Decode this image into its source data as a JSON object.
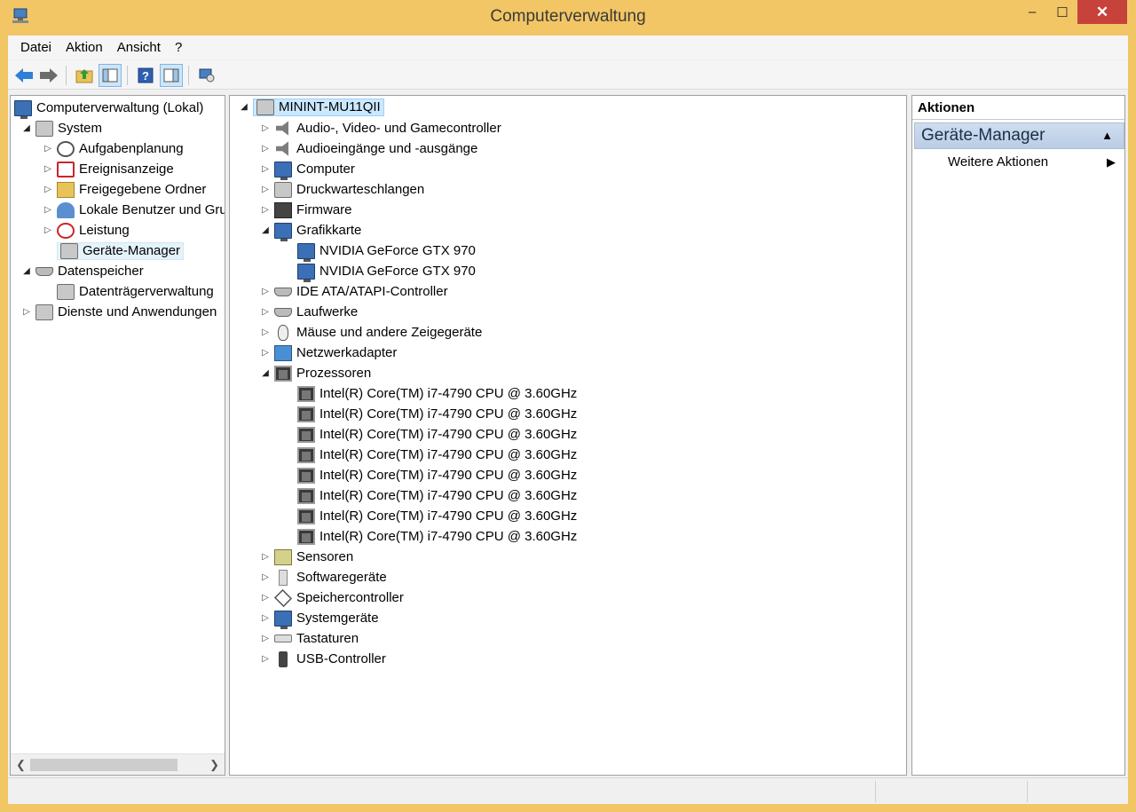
{
  "window": {
    "title": "Computerverwaltung",
    "minimize_label": "‒",
    "maximize_label": "☐",
    "close_label": "✕"
  },
  "menubar": {
    "items": [
      {
        "label": "Datei"
      },
      {
        "label": "Aktion"
      },
      {
        "label": "Ansicht"
      },
      {
        "label": "?"
      }
    ]
  },
  "toolbar": {
    "back_icon": "arrow-left-icon",
    "forward_icon": "arrow-right-icon",
    "up_icon": "folder-up-icon",
    "console_tree_icon": "show-hide-tree-icon",
    "help_icon": "help-icon",
    "action_pane_icon": "show-hide-action-pane-icon",
    "properties_icon": "properties-icon"
  },
  "left_tree": {
    "root": "Computerverwaltung (Lokal)",
    "system": "System",
    "system_children": [
      "Aufgabenplanung",
      "Ereignisanzeige",
      "Freigegebene Ordner",
      "Lokale Benutzer und Gruppen",
      "Leistung",
      "Geräte-Manager"
    ],
    "storage": "Datenspeicher",
    "storage_children": [
      "Datenträgerverwaltung"
    ],
    "services": "Dienste und Anwendungen"
  },
  "device_tree": {
    "computer_name": "MININT-MU11QII",
    "categories_top": [
      "Audio-, Video- und Gamecontroller",
      "Audioeingänge und -ausgänge",
      "Computer",
      "Druckwarteschlangen",
      "Firmware"
    ],
    "graphics": {
      "label": "Grafikkarte",
      "devices": [
        "NVIDIA GeForce GTX 970",
        "NVIDIA GeForce GTX 970"
      ]
    },
    "categories_mid": [
      "IDE ATA/ATAPI-Controller",
      "Laufwerke",
      "Mäuse und andere Zeigegeräte",
      "Netzwerkadapter"
    ],
    "processors": {
      "label": "Prozessoren",
      "devices": [
        "Intel(R) Core(TM) i7-4790 CPU @ 3.60GHz",
        "Intel(R) Core(TM) i7-4790 CPU @ 3.60GHz",
        "Intel(R) Core(TM) i7-4790 CPU @ 3.60GHz",
        "Intel(R) Core(TM) i7-4790 CPU @ 3.60GHz",
        "Intel(R) Core(TM) i7-4790 CPU @ 3.60GHz",
        "Intel(R) Core(TM) i7-4790 CPU @ 3.60GHz",
        "Intel(R) Core(TM) i7-4790 CPU @ 3.60GHz",
        "Intel(R) Core(TM) i7-4790 CPU @ 3.60GHz"
      ]
    },
    "categories_bottom": [
      "Sensoren",
      "Softwaregeräte",
      "Speichercontroller",
      "Systemgeräte",
      "Tastaturen",
      "USB-Controller"
    ]
  },
  "actions": {
    "header": "Aktionen",
    "section": "Geräte-Manager",
    "items": [
      "Weitere Aktionen"
    ]
  },
  "colors": {
    "title_bar": "#f2c665",
    "close_button": "#c7423a",
    "selection": "#cce8ff"
  }
}
